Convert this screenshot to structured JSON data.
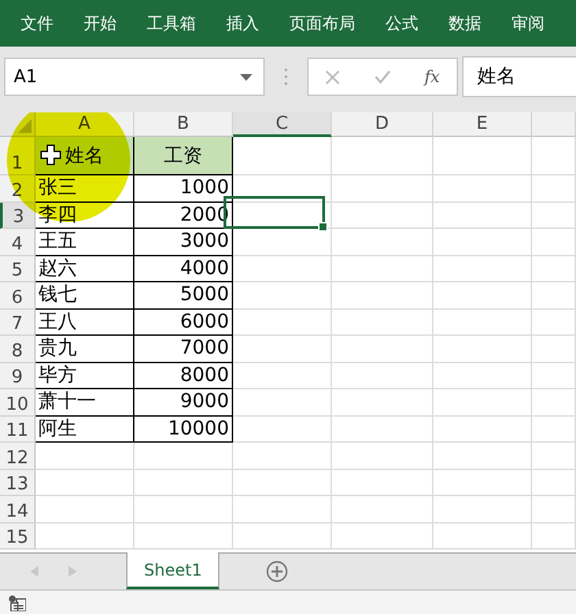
{
  "ribbon_tabs": [
    "文件",
    "开始",
    "工具箱",
    "插入",
    "页面布局",
    "公式",
    "数据",
    "审阅"
  ],
  "name_box": {
    "value": "A1"
  },
  "formula_bar": {
    "function_label": "fx",
    "value": "姓名"
  },
  "columns": [
    {
      "label": "A",
      "selected": false
    },
    {
      "label": "B",
      "selected": false
    },
    {
      "label": "C",
      "selected": true
    },
    {
      "label": "D",
      "selected": false
    },
    {
      "label": "E",
      "selected": false
    }
  ],
  "rows": [
    {
      "number": "1",
      "selected": false,
      "kind": "header",
      "cells": [
        "姓名",
        "工资"
      ]
    },
    {
      "number": "2",
      "selected": false,
      "kind": "data",
      "cells": [
        "张三",
        "1000"
      ]
    },
    {
      "number": "3",
      "selected": true,
      "kind": "data",
      "cells": [
        "李四",
        "2000"
      ]
    },
    {
      "number": "4",
      "selected": false,
      "kind": "data",
      "cells": [
        "王五",
        "3000"
      ]
    },
    {
      "number": "5",
      "selected": false,
      "kind": "data",
      "cells": [
        "赵六",
        "4000"
      ]
    },
    {
      "number": "6",
      "selected": false,
      "kind": "data",
      "cells": [
        "钱七",
        "5000"
      ]
    },
    {
      "number": "7",
      "selected": false,
      "kind": "data",
      "cells": [
        "王八",
        "6000"
      ]
    },
    {
      "number": "8",
      "selected": false,
      "kind": "data",
      "cells": [
        "贵九",
        "7000"
      ]
    },
    {
      "number": "9",
      "selected": false,
      "kind": "data",
      "cells": [
        "毕方",
        "8000"
      ]
    },
    {
      "number": "10",
      "selected": false,
      "kind": "data",
      "cells": [
        "萧十一",
        "9000"
      ]
    },
    {
      "number": "11",
      "selected": false,
      "kind": "data",
      "cells": [
        "阿生",
        "10000"
      ]
    },
    {
      "number": "12",
      "selected": false,
      "kind": "empty",
      "cells": []
    },
    {
      "number": "13",
      "selected": false,
      "kind": "empty",
      "cells": []
    },
    {
      "number": "14",
      "selected": false,
      "kind": "empty",
      "cells": []
    },
    {
      "number": "15",
      "selected": false,
      "kind": "empty",
      "cells": []
    }
  ],
  "sheet_tabs": [
    {
      "label": "Sheet1",
      "selected": true
    }
  ]
}
